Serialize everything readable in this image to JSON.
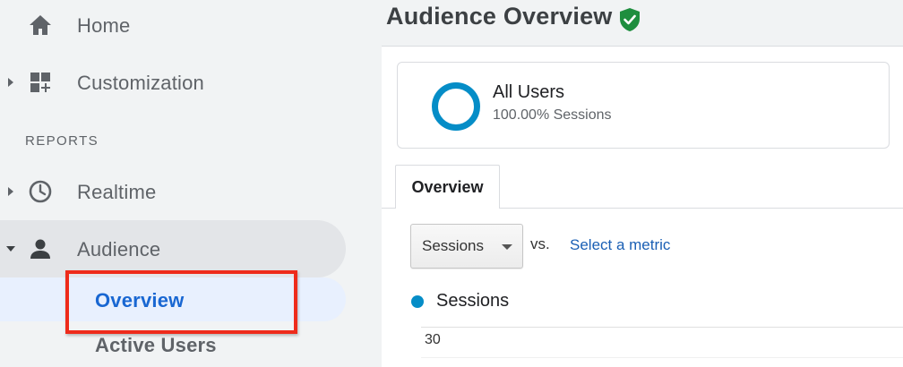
{
  "sidebar": {
    "items": [
      {
        "label": "Home",
        "icon": "home-icon"
      },
      {
        "label": "Customization",
        "icon": "dashboard-plus-icon"
      }
    ],
    "section_label": "REPORTS",
    "reports": [
      {
        "label": "Realtime",
        "icon": "clock-icon"
      },
      {
        "label": "Audience",
        "icon": "person-icon",
        "expanded": true
      }
    ],
    "audience_children": [
      {
        "label": "Overview",
        "selected": true
      },
      {
        "label": "Active Users"
      }
    ]
  },
  "header": {
    "title": "Audience Overview",
    "verified_icon": "shield-check-icon"
  },
  "segment": {
    "name": "All Users",
    "percentage": "100.00% Sessions"
  },
  "tabs": [
    {
      "label": "Overview",
      "active": true
    }
  ],
  "metric_picker": {
    "selected": "Sessions",
    "vs_label": "vs.",
    "select_metric_label": "Select a metric"
  },
  "chart": {
    "legend_label": "Sessions",
    "y_tick_top": "30"
  },
  "colors": {
    "sidebar_bg": "#f1f3f4",
    "selected_bg": "#e8f0fe",
    "selected_text": "#1967d2",
    "highlight_box": "#ee2b1b",
    "series": "#058dc7",
    "shield": "#1e8e3e",
    "link": "#1a5fb4"
  }
}
